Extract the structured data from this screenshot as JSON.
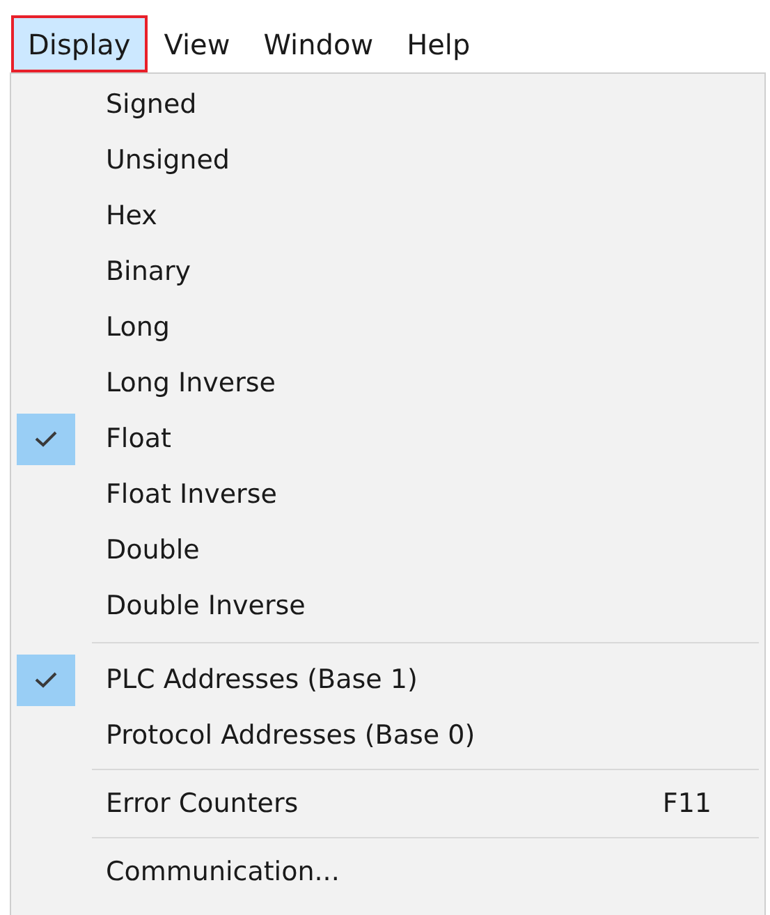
{
  "menu_bar": [
    {
      "label": "Display",
      "selected": true
    },
    {
      "label": "View",
      "selected": false
    },
    {
      "label": "Window",
      "selected": false
    },
    {
      "label": "Help",
      "selected": false
    }
  ],
  "menu": {
    "sections": [
      [
        {
          "label": "Signed",
          "checked": false
        },
        {
          "label": "Unsigned",
          "checked": false
        },
        {
          "label": "Hex",
          "checked": false
        },
        {
          "label": "Binary",
          "checked": false
        },
        {
          "label": "Long",
          "checked": false
        },
        {
          "label": "Long Inverse",
          "checked": false
        },
        {
          "label": "Float",
          "checked": true
        },
        {
          "label": "Float Inverse",
          "checked": false
        },
        {
          "label": "Double",
          "checked": false
        },
        {
          "label": "Double Inverse",
          "checked": false
        }
      ],
      [
        {
          "label": "PLC Addresses (Base 1)",
          "checked": true
        },
        {
          "label": "Protocol Addresses (Base 0)",
          "checked": false
        }
      ],
      [
        {
          "label": "Error Counters",
          "checked": false,
          "shortcut": "F11"
        }
      ],
      [
        {
          "label": "Communication...",
          "checked": false
        }
      ]
    ]
  }
}
